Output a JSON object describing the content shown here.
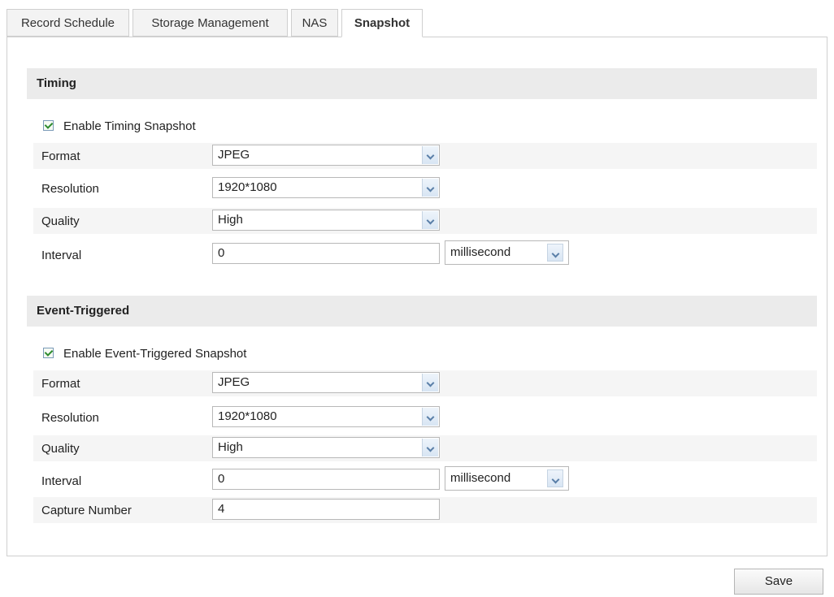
{
  "tabs": [
    {
      "label": "Record Schedule"
    },
    {
      "label": "Storage Management"
    },
    {
      "label": "NAS"
    },
    {
      "label": "Snapshot"
    }
  ],
  "timing": {
    "title": "Timing",
    "enable_label": "Enable Timing Snapshot",
    "enable_checked": true,
    "format_label": "Format",
    "format_value": "JPEG",
    "resolution_label": "Resolution",
    "resolution_value": "1920*1080",
    "quality_label": "Quality",
    "quality_value": "High",
    "interval_label": "Interval",
    "interval_value": "0",
    "interval_unit": "millisecond"
  },
  "event": {
    "title": "Event-Triggered",
    "enable_label": "Enable Event-Triggered Snapshot",
    "enable_checked": true,
    "format_label": "Format",
    "format_value": "JPEG",
    "resolution_label": "Resolution",
    "resolution_value": "1920*1080",
    "quality_label": "Quality",
    "quality_value": "High",
    "interval_label": "Interval",
    "interval_value": "0",
    "interval_unit": "millisecond",
    "capture_label": "Capture Number",
    "capture_value": "4"
  },
  "save_label": "Save"
}
